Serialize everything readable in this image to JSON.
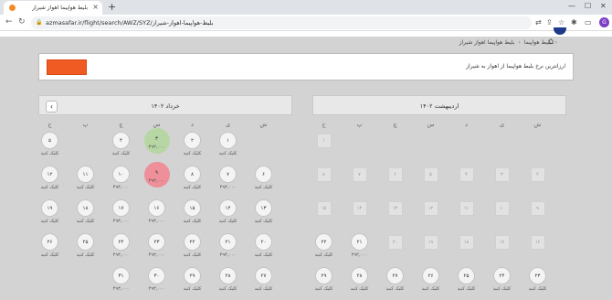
{
  "browser": {
    "tab_title": "بلیط هواپیما اهواز شیراز",
    "url": "azmasafar.ir/flight/search/AWZ/SYZ/بلیط-هواپیما-اهواز-شیراز",
    "avatar_letter": "G",
    "new_tab": "+",
    "close_tab": "×"
  },
  "site": {
    "breadcrumb": [
      "بلیط هواپیما",
      "بلیط هواپیما اهواز شیراز"
    ],
    "info_text": "ارزانترین نرخ بلیط هواپیما از اهواز به شیراز",
    "accent": "#f05a23"
  },
  "weekdays": [
    "ش",
    "ی",
    "د",
    "س",
    "چ",
    "پ",
    "ج"
  ],
  "left_month": {
    "title": "خرداد ۱۴۰۲",
    "cells": [
      {
        "day": "۱",
        "label": "کلیک کنید",
        "col": 1,
        "row": 0
      },
      {
        "day": "۲",
        "label": "کلیک کنید",
        "col": 2,
        "row": 0
      },
      {
        "day": "۳",
        "label": "۴۹۳,۰۰۰",
        "col": 3,
        "row": 0,
        "hl": "green"
      },
      {
        "day": "۴",
        "label": "کلیک کنید",
        "col": 4,
        "row": 0
      },
      {
        "day": "۵",
        "label": "کلیک کنید",
        "col": 6,
        "row": 0
      },
      {
        "day": "۶",
        "label": "کلیک کنید",
        "col": 0,
        "row": 1
      },
      {
        "day": "۷",
        "label": "۴۹۳,۰۰۰",
        "col": 1,
        "row": 1
      },
      {
        "day": "۸",
        "label": "کلیک کنید",
        "col": 2,
        "row": 1
      },
      {
        "day": "۹",
        "label": "۴۹۳,۰۰۰",
        "col": 3,
        "row": 1,
        "hl": "red"
      },
      {
        "day": "۱۰",
        "label": "۴۹۳,۰۰۰",
        "col": 4,
        "row": 1
      },
      {
        "day": "۱۱",
        "label": "کلیک کنید",
        "col": 5,
        "row": 1
      },
      {
        "day": "۱۲",
        "label": "کلیک کنید",
        "col": 6,
        "row": 1
      },
      {
        "day": "۱۳",
        "label": "کلیک کنید",
        "col": 0,
        "row": 2
      },
      {
        "day": "۱۴",
        "label": "کلیک کنید",
        "col": 1,
        "row": 2
      },
      {
        "day": "۱۵",
        "label": "کلیک کنید",
        "col": 2,
        "row": 2
      },
      {
        "day": "۱۶",
        "label": "۴۹۳,۰۰۰",
        "col": 3,
        "row": 2
      },
      {
        "day": "۱۷",
        "label": "۴۹۳,۰۰۰",
        "col": 4,
        "row": 2
      },
      {
        "day": "۱۸",
        "label": "کلیک کنید",
        "col": 5,
        "row": 2
      },
      {
        "day": "۱۹",
        "label": "کلیک کنید",
        "col": 6,
        "row": 2
      },
      {
        "day": "۲۰",
        "label": "کلیک کنید",
        "col": 0,
        "row": 3
      },
      {
        "day": "۲۱",
        "label": "۴۹۳,۰۰۰",
        "col": 1,
        "row": 3
      },
      {
        "day": "۲۲",
        "label": "کلیک کنید",
        "col": 2,
        "row": 3
      },
      {
        "day": "۲۳",
        "label": "۴۹۳,۰۰۰",
        "col": 3,
        "row": 3
      },
      {
        "day": "۲۴",
        "label": "۴۹۳,۰۰۰",
        "col": 4,
        "row": 3
      },
      {
        "day": "۲۵",
        "label": "کلیک کنید",
        "col": 5,
        "row": 3
      },
      {
        "day": "۲۶",
        "label": "کلیک کنید",
        "col": 6,
        "row": 3
      },
      {
        "day": "۲۷",
        "label": "کلیک کنید",
        "col": 0,
        "row": 4
      },
      {
        "day": "۲۸",
        "label": "کلیک کنید",
        "col": 1,
        "row": 4
      },
      {
        "day": "۲۹",
        "label": "کلیک کنید",
        "col": 2,
        "row": 4
      },
      {
        "day": "۳۰",
        "label": "۴۹۳,۰۰۰",
        "col": 3,
        "row": 4
      },
      {
        "day": "۳۱",
        "label": "۴۹۳,۰۰۰",
        "col": 4,
        "row": 4
      }
    ]
  },
  "right_month": {
    "title": "اردیبهشت ۱۴۰۲",
    "squares": [
      {
        "day": "۱",
        "col": 6,
        "row": 0
      },
      {
        "day": "۲",
        "col": 0,
        "row": 1
      },
      {
        "day": "۳",
        "col": 1,
        "row": 1
      },
      {
        "day": "۴",
        "col": 2,
        "row": 1
      },
      {
        "day": "۵",
        "col": 3,
        "row": 1
      },
      {
        "day": "۶",
        "col": 4,
        "row": 1
      },
      {
        "day": "۷",
        "col": 5,
        "row": 1
      },
      {
        "day": "۸",
        "col": 6,
        "row": 1
      },
      {
        "day": "۹",
        "col": 0,
        "row": 2
      },
      {
        "day": "۱۰",
        "col": 1,
        "row": 2
      },
      {
        "day": "۱۱",
        "col": 2,
        "row": 2
      },
      {
        "day": "۱۲",
        "col": 3,
        "row": 2
      },
      {
        "day": "۱۳",
        "col": 4,
        "row": 2
      },
      {
        "day": "۱۴",
        "col": 5,
        "row": 2
      },
      {
        "day": "۱۵",
        "col": 6,
        "row": 2
      },
      {
        "day": "۱۶",
        "col": 0,
        "row": 3
      },
      {
        "day": "۱۷",
        "col": 1,
        "row": 3
      },
      {
        "day": "۱۸",
        "col": 2,
        "row": 3
      },
      {
        "day": "۱۹",
        "col": 3,
        "row": 3
      },
      {
        "day": "۲۰",
        "col": 4,
        "row": 3
      }
    ],
    "cells": [
      {
        "day": "۲۱",
        "label": "۴۹۳,۰۰۰",
        "col": 5,
        "row": 3
      },
      {
        "day": "۲۲",
        "label": "کلیک کنید",
        "col": 6,
        "row": 3
      },
      {
        "day": "۲۳",
        "label": "کلیک کنید",
        "col": 0,
        "row": 4
      },
      {
        "day": "۲۴",
        "label": "کلیک کنید",
        "col": 1,
        "row": 4
      },
      {
        "day": "۲۵",
        "label": "کلیک کنید",
        "col": 2,
        "row": 4
      },
      {
        "day": "۲۶",
        "label": "کلیک کنید",
        "col": 3,
        "row": 4
      },
      {
        "day": "۲۷",
        "label": "کلیک کنید",
        "col": 4,
        "row": 4
      },
      {
        "day": "۲۸",
        "label": "کلیک کنید",
        "col": 5,
        "row": 4
      },
      {
        "day": "۲۹",
        "label": "کلیک کنید",
        "col": 6,
        "row": 4
      }
    ]
  }
}
